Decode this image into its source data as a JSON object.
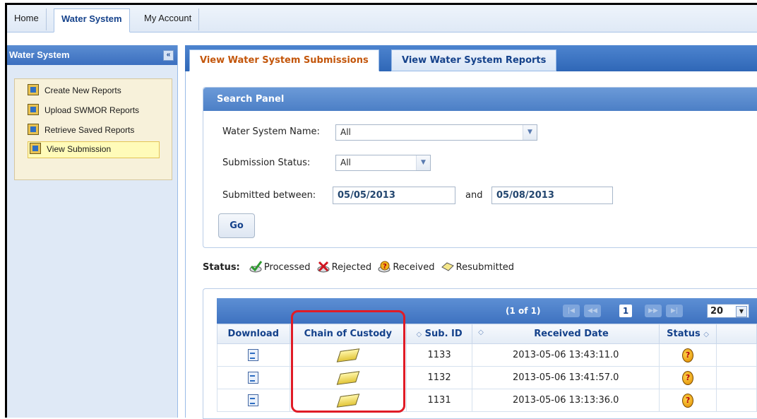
{
  "top_tabs": [
    {
      "label": "Home"
    },
    {
      "label": "Water System"
    },
    {
      "label": "My Account"
    }
  ],
  "left_panel": {
    "title": "Water System",
    "collapse_glyph": "«",
    "items": [
      {
        "label": "Create New Reports",
        "icon": "report-icon"
      },
      {
        "label": "Upload SWMOR Reports",
        "icon": "report-icon"
      },
      {
        "label": "Retrieve Saved Reports",
        "icon": "report-icon"
      },
      {
        "label": "View Submission",
        "icon": "report-icon",
        "selected": true
      }
    ]
  },
  "main_tabs": [
    {
      "label": "View Water System Submissions",
      "active": true
    },
    {
      "label": "View Water System Reports",
      "active": false
    }
  ],
  "search_panel": {
    "title": "Search Panel",
    "water_system_label": "Water System Name:",
    "water_system_value": "All",
    "status_label": "Submission Status:",
    "status_value": "All",
    "submitted_between_label": "Submitted between:",
    "date_from": "05/05/2013",
    "and_label": "and",
    "date_to": "05/08/2013",
    "go_label": "Go"
  },
  "status_legend": {
    "label": "Status:",
    "items": [
      {
        "label": "Processed",
        "icon": "processed-icon"
      },
      {
        "label": "Rejected",
        "icon": "rejected-icon"
      },
      {
        "label": "Received",
        "icon": "received-icon"
      },
      {
        "label": "Resubmitted",
        "icon": "resubmitted-icon"
      }
    ]
  },
  "pager": {
    "page_info": "(1 of 1)",
    "current_page": "1",
    "rows_per_page": "20"
  },
  "table": {
    "columns": [
      "Download",
      "Chain of Custody",
      "Sub. ID",
      "Received Date",
      "Status"
    ],
    "rows": [
      {
        "sub_id": "1133",
        "received": "2013-05-06 13:43:11.0",
        "status": "Received"
      },
      {
        "sub_id": "1132",
        "received": "2013-05-06 13:41:57.0",
        "status": "Received"
      },
      {
        "sub_id": "1131",
        "received": "2013-05-06 13:13:36.0",
        "status": "Received"
      }
    ]
  },
  "colors": {
    "accent": "#15428b",
    "active_tab_text": "#c3560b",
    "highlight": "#e01b26"
  }
}
